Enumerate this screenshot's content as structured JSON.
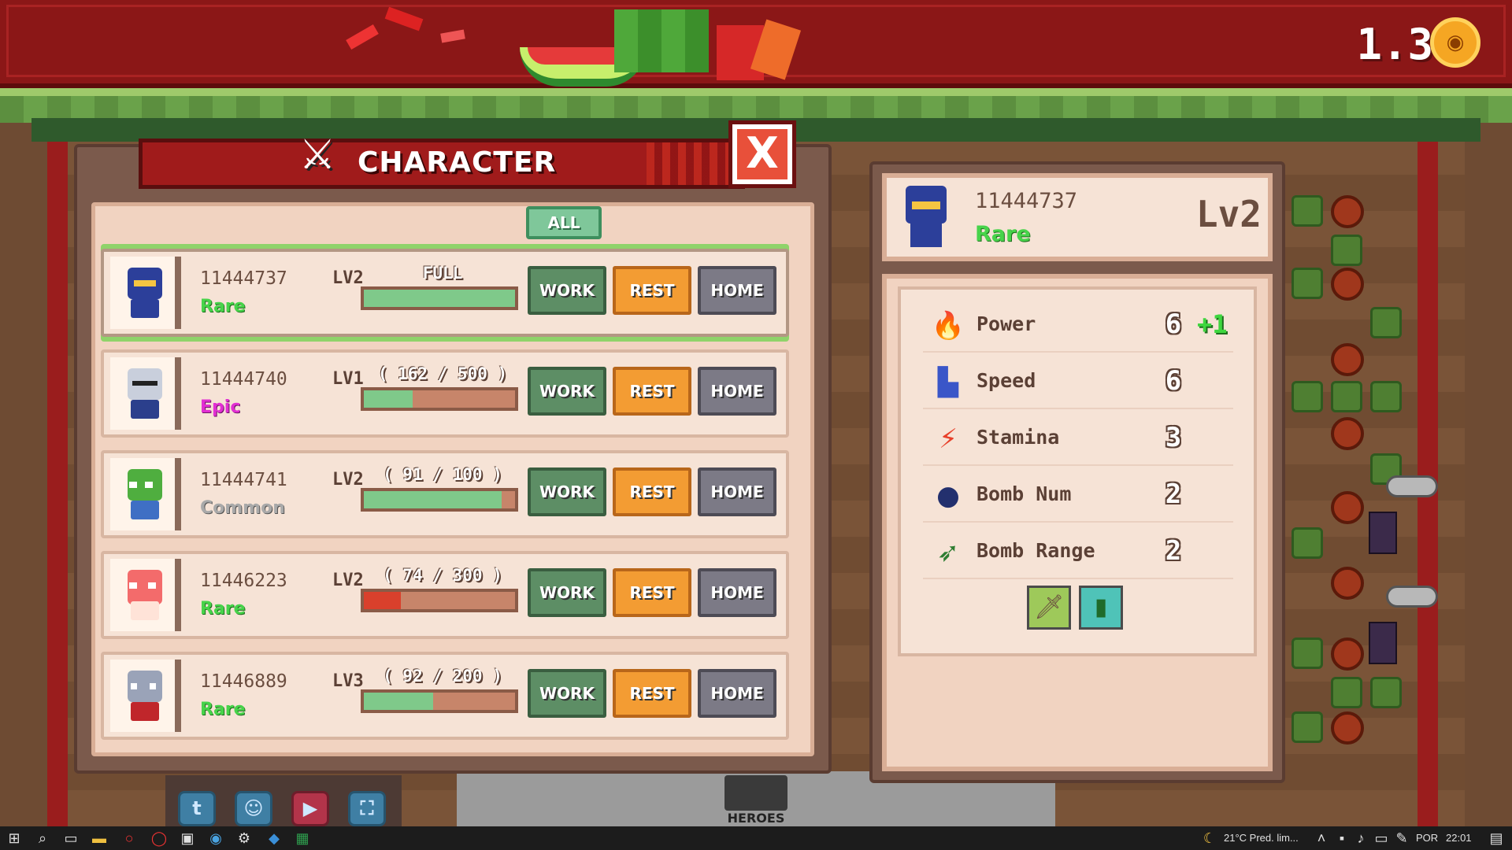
{
  "top_bar": {
    "coin_value": "1.3"
  },
  "panel": {
    "title": "CHARACTER",
    "close_label": "X",
    "filter_label": "ALL"
  },
  "buttons": {
    "work": "WORK",
    "rest": "REST",
    "home": "HOME"
  },
  "characters": [
    {
      "id": "11444737",
      "level": "LV2",
      "rarity": "Rare",
      "stamina_label": "FULL",
      "stamina_fraction": 1.0,
      "selected": true
    },
    {
      "id": "11444740",
      "level": "LV1",
      "rarity": "Epic",
      "stamina_label": "( 162 / 500 )",
      "stamina_fraction": 0.324
    },
    {
      "id": "11444741",
      "level": "LV2",
      "rarity": "Common",
      "stamina_label": "( 91 / 100 )",
      "stamina_fraction": 0.91
    },
    {
      "id": "11446223",
      "level": "LV2",
      "rarity": "Rare",
      "stamina_label": "( 74 / 300 )",
      "stamina_fraction": 0.247
    },
    {
      "id": "11446889",
      "level": "LV3",
      "rarity": "Rare",
      "stamina_label": "( 92 / 200 )",
      "stamina_fraction": 0.46
    }
  ],
  "detail": {
    "id": "11444737",
    "rarity": "Rare",
    "level": "Lv2",
    "stats": [
      {
        "name": "Power",
        "value": "6",
        "bonus": "+1",
        "icon": "fire-icon"
      },
      {
        "name": "Speed",
        "value": "6",
        "bonus": "",
        "icon": "boot-icon"
      },
      {
        "name": "Stamina",
        "value": "3",
        "bonus": "",
        "icon": "lightning-icon"
      },
      {
        "name": "Bomb Num",
        "value": "2",
        "bonus": "",
        "icon": "bomb-icon"
      },
      {
        "name": "Bomb Range",
        "value": "2",
        "bonus": "",
        "icon": "bow-icon"
      }
    ],
    "items": [
      "sword-item-icon",
      "battery-item-icon"
    ]
  },
  "colors": {
    "rare": "#47d34a",
    "epic": "#e22fd3",
    "common": "#a9a9a9",
    "stamina_green": "#7fc98a",
    "stamina_red": "#d9402c"
  },
  "bottom": {
    "heroes_label": "HEROES"
  },
  "taskbar": {
    "weather": "21°C  Pred. lim...",
    "language": "POR",
    "time": "22:01"
  }
}
